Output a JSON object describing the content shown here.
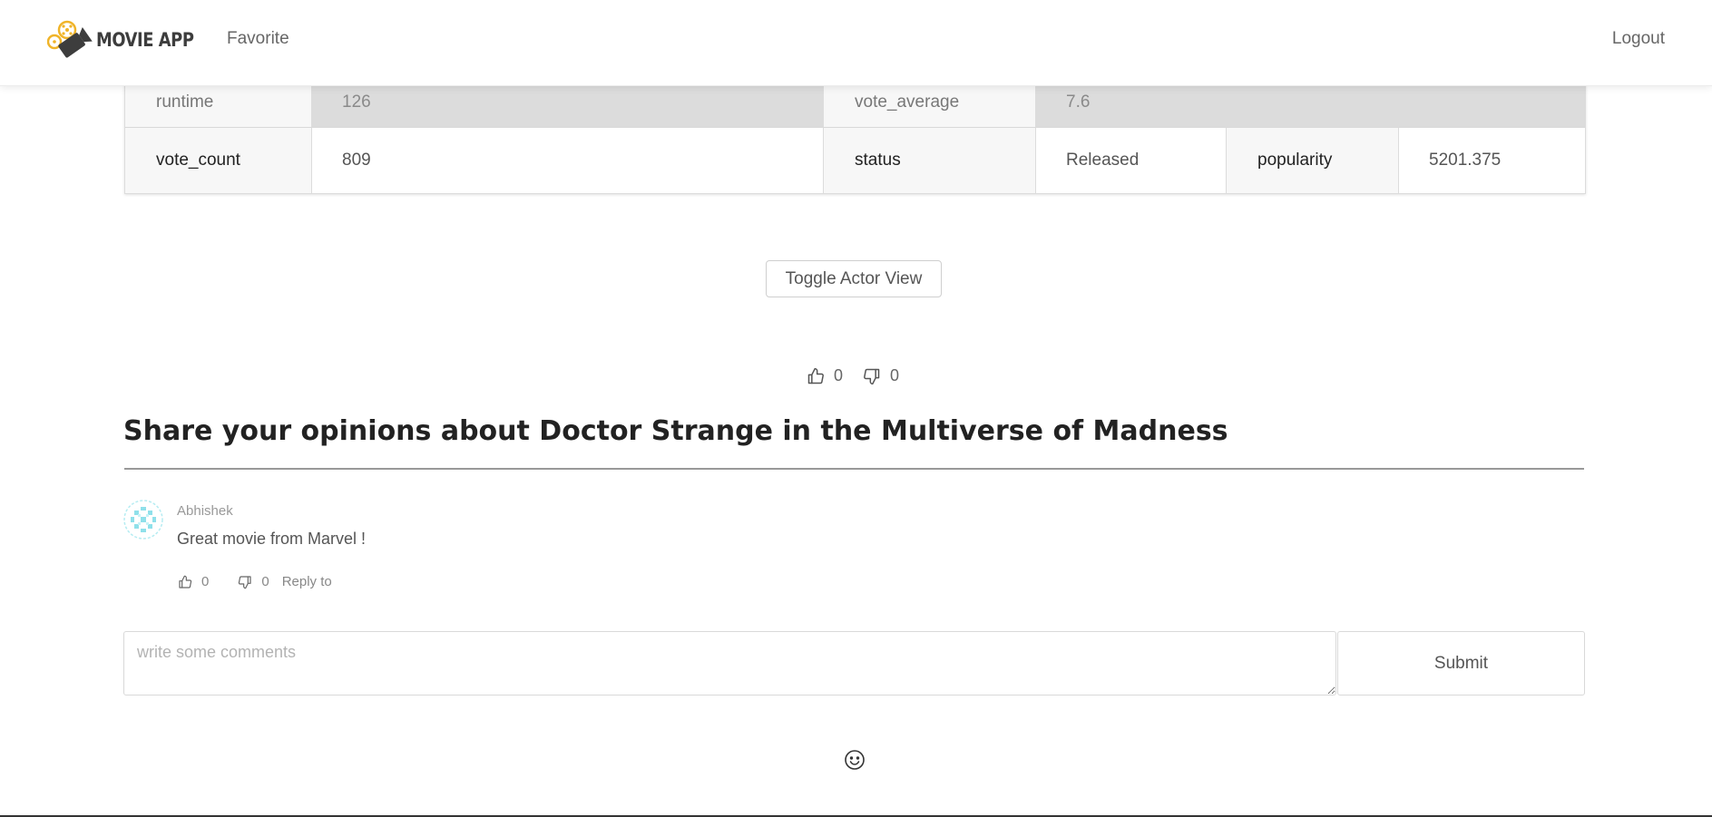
{
  "header": {
    "logo_text": "MOVIE APP",
    "nav_favorite": "Favorite",
    "nav_logout": "Logout"
  },
  "info_table": {
    "rows": [
      [
        {
          "label": "runtime",
          "value": "126"
        },
        {
          "label": "vote_average",
          "value": "7.6"
        }
      ],
      [
        {
          "label": "vote_count",
          "value": "809"
        },
        {
          "label": "status",
          "value": "Released"
        },
        {
          "label": "popularity",
          "value": "5201.375"
        }
      ]
    ]
  },
  "toggle_button": "Toggle Actor View",
  "movie_votes": {
    "likes": "0",
    "dislikes": "0"
  },
  "comments_section": {
    "title": "Share your opinions about Doctor Strange in the Multiverse of Madness",
    "comments": [
      {
        "author": "Abhishek",
        "text": "Great movie from Marvel !",
        "likes": "0",
        "dislikes": "0",
        "reply_label": "Reply to"
      }
    ],
    "input_placeholder": "write some comments",
    "submit_label": "Submit"
  },
  "icons": {
    "like": "thumbs-up-icon",
    "dislike": "thumbs-down-icon",
    "emoji": "smile-icon",
    "logo": "film-camera-logo"
  },
  "colors": {
    "logo_accent": "#f0b429",
    "logo_dark": "#3d3d3d"
  }
}
